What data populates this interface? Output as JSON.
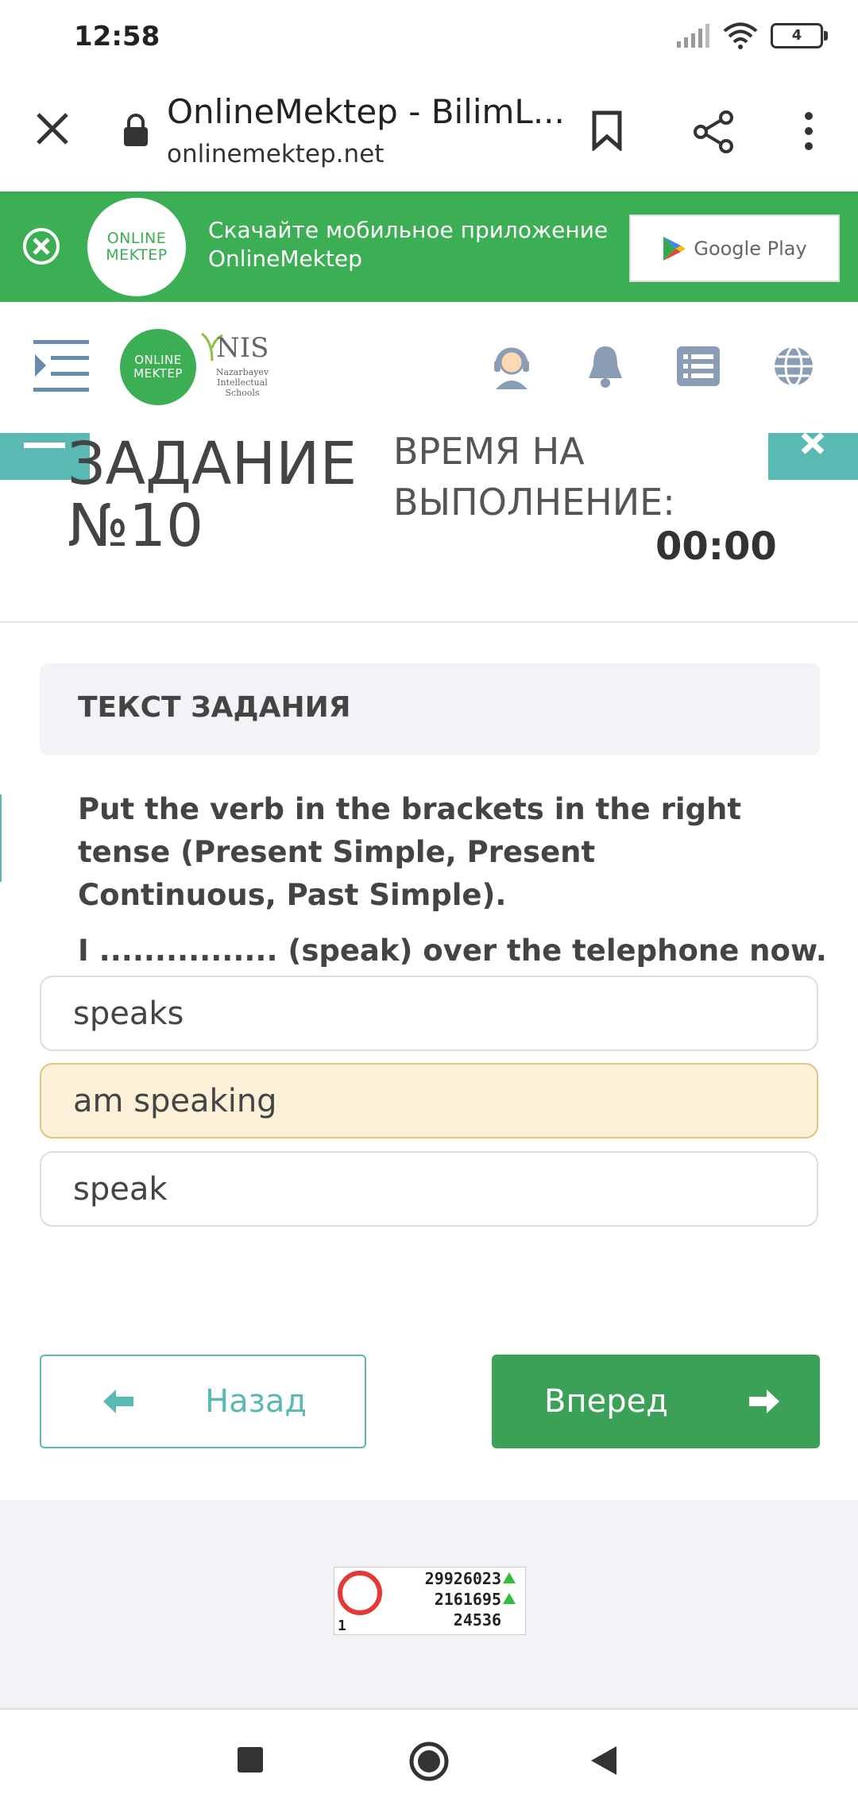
{
  "status_bar": {
    "time": "12:58",
    "battery": "4"
  },
  "browser": {
    "title": "OnlineMektep - BilimL...",
    "url": "onlinemektep.net"
  },
  "banner": {
    "logo_top": "ONLINE",
    "logo_bottom": "MEKTEP",
    "text_line1": "Скачайте мобильное приложение",
    "text_line2": "OnlineMektep",
    "store_label": "Google Play"
  },
  "header": {
    "logo_top": "ONLINE",
    "logo_bottom": "MEKTEP",
    "nis_title": "NIS",
    "nis_subtitle_1": "Nazarbayev",
    "nis_subtitle_2": "Intellectual",
    "nis_subtitle_3": "Schools"
  },
  "task": {
    "title_line1": "ЗАДАНИЕ",
    "title_line2": "№10",
    "time_label_line1": "ВРЕМЯ НА",
    "time_label_line2": "ВЫПОЛНЕНИЕ:",
    "time_value": "00:00",
    "section_title": "ТЕКСТ ЗАДАНИЯ",
    "question": "Put the verb in the brackets in the right tense (Present Simple, Present Continuous, Past Simple).",
    "sentence": "I ................ (speak) over the telephone now."
  },
  "options": [
    {
      "label": "speaks",
      "selected": false
    },
    {
      "label": "am speaking",
      "selected": true
    },
    {
      "label": "speak",
      "selected": false
    }
  ],
  "navigation": {
    "back_label": "Назад",
    "next_label": "Вперед"
  },
  "counter": {
    "line1": "29926023",
    "line2": "2161695",
    "line3": "24536",
    "small": "1"
  },
  "colors": {
    "brand_green": "#3cae54",
    "teal": "#5ab9b2",
    "selected_bg": "#fcf1d8"
  }
}
